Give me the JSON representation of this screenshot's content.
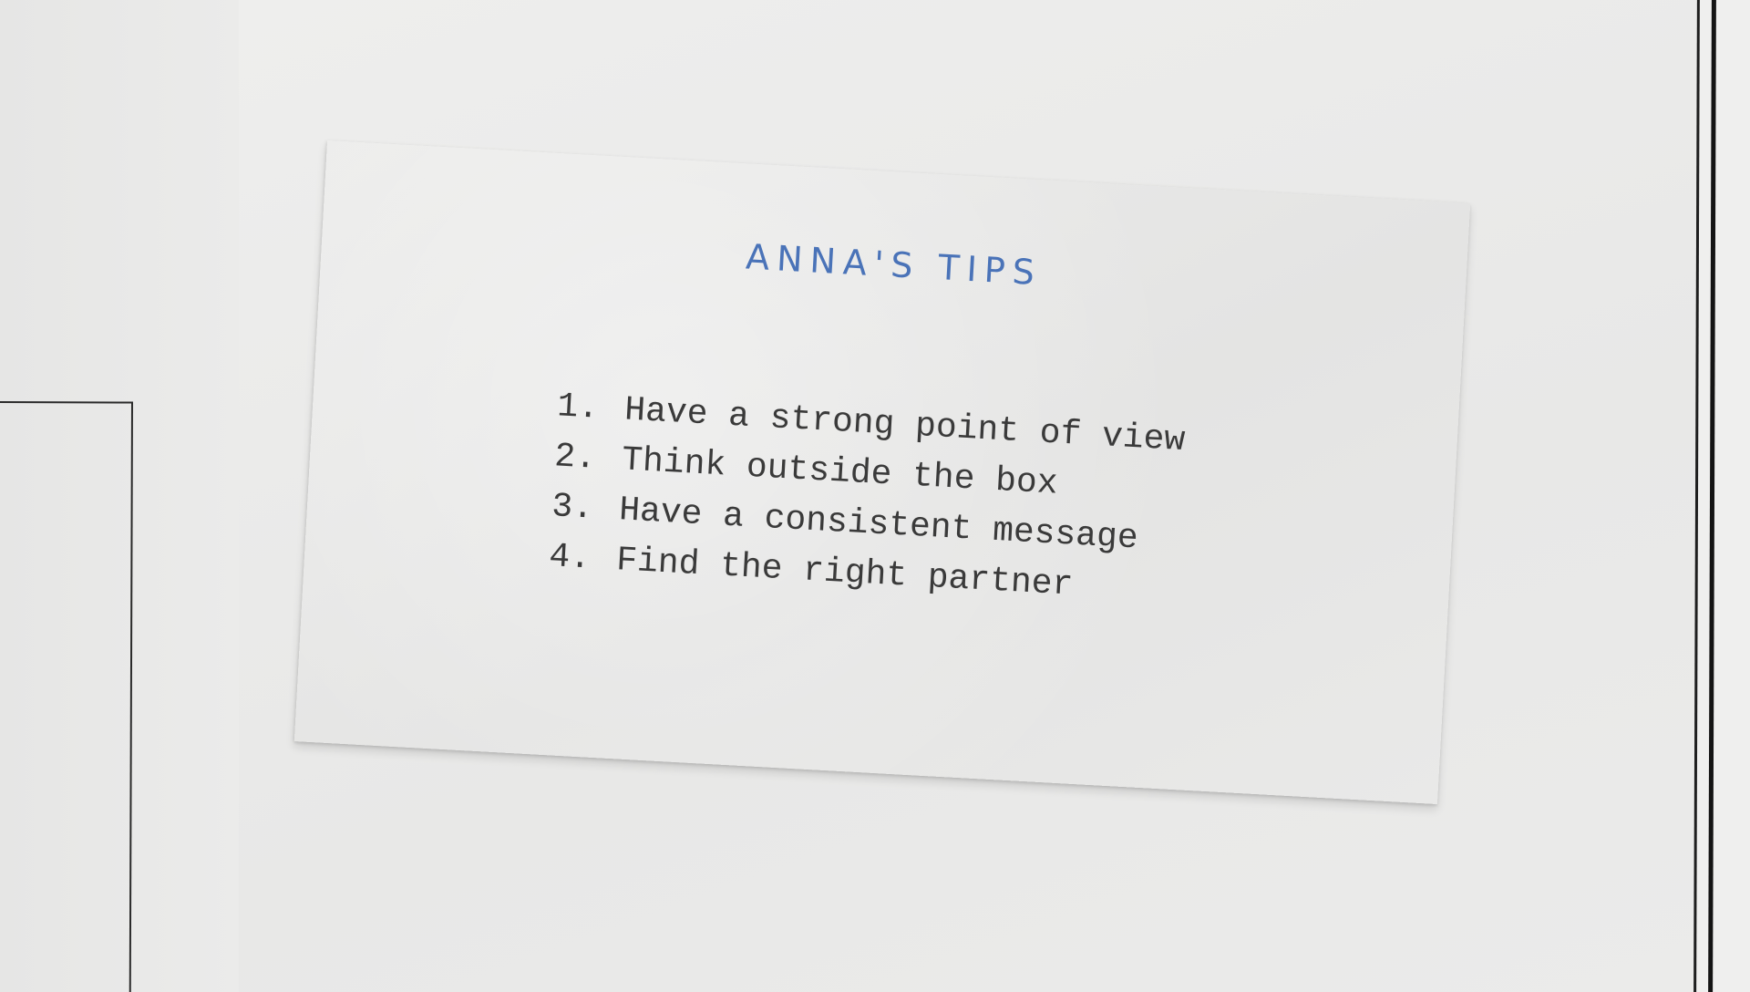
{
  "card": {
    "title": "ANNA'S TIPS",
    "tips": [
      {
        "number": "1.",
        "text": "Have a strong point of view"
      },
      {
        "number": "2.",
        "text": "Think outside the box"
      },
      {
        "number": "3.",
        "text": "Have a consistent message"
      },
      {
        "number": "4.",
        "text": "Find the right partner"
      }
    ]
  },
  "colors": {
    "title": "#4a73b8",
    "body_text": "#3a3a3a",
    "paper": "#e6e6e5"
  }
}
